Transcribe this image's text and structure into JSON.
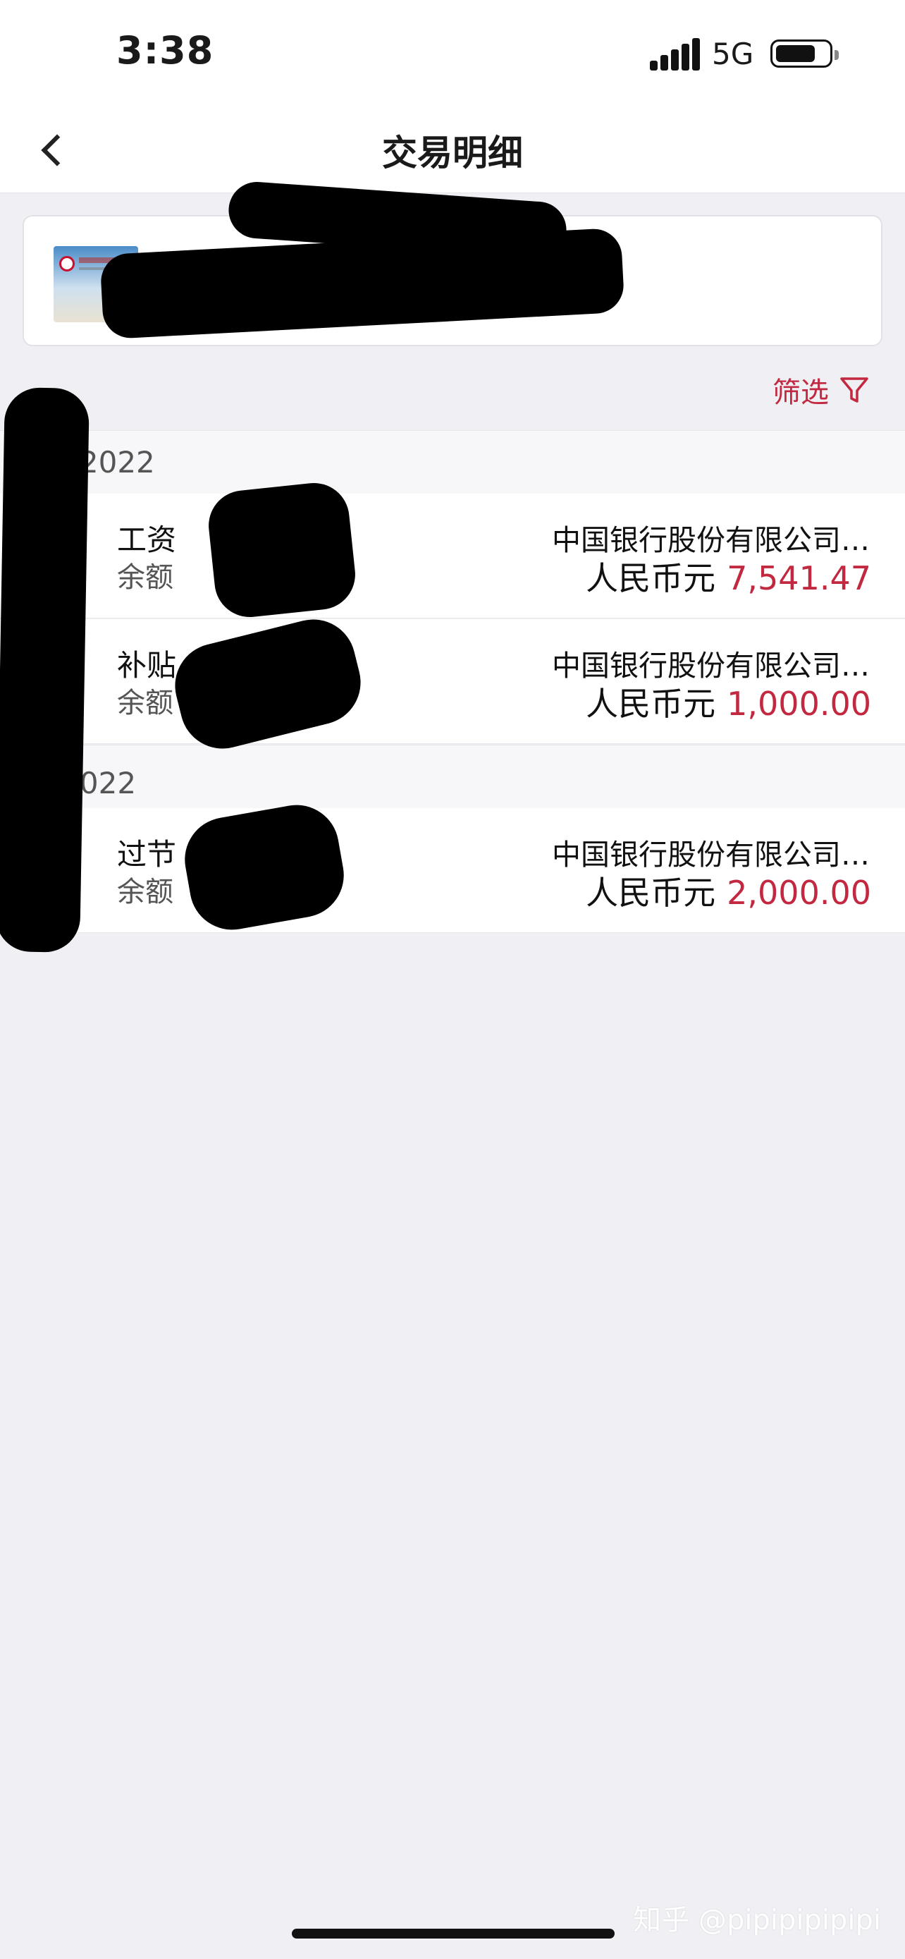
{
  "status_bar": {
    "time": "3:38",
    "network": "5G",
    "signal_icon": "signal-bars-icon",
    "battery_icon": "battery-icon"
  },
  "nav": {
    "title": "交易明细",
    "back_icon": "chevron-left-icon"
  },
  "account_card": {
    "card_image": "bank-card-thumbnail"
  },
  "filter": {
    "label": "筛选",
    "icon": "funnel-icon",
    "color": "#c2283f"
  },
  "groups": [
    {
      "header": "0…/2022",
      "transactions": [
        {
          "description": "工资",
          "balance_label": "余额",
          "payer": "中国银行股份有限公司…",
          "currency": "人民币元",
          "amount": "7,541.47"
        },
        {
          "description": "补贴",
          "balance_label": "余额",
          "payer": "中国银行股份有限公司…",
          "currency": "人民币元",
          "amount": "1,000.00"
        }
      ]
    },
    {
      "header": "月/2022",
      "transactions": [
        {
          "description": "过节",
          "balance_label": "余额",
          "payer": "中国银行股份有限公司…",
          "currency": "人民币元",
          "amount": "2,000.00"
        }
      ]
    }
  ],
  "watermark": "知乎 @pipipipipipi",
  "colors": {
    "accent": "#c2283f",
    "background": "#efeff4"
  }
}
